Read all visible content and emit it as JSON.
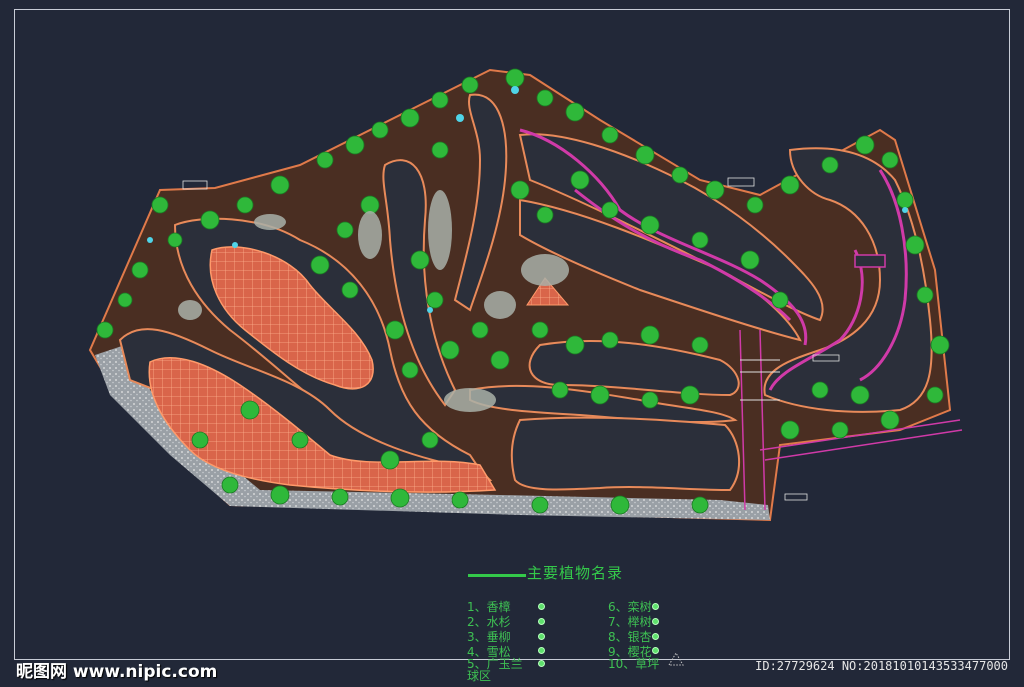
{
  "legend": {
    "title": "主要植物名录",
    "items_left": [
      {
        "label": "1、香樟"
      },
      {
        "label": "2、水杉"
      },
      {
        "label": "3、垂柳"
      },
      {
        "label": "4、雪松"
      },
      {
        "label": "5、广玉兰"
      }
    ],
    "items_left_extra": "球区",
    "items_right": [
      {
        "label": "6、栾树"
      },
      {
        "label": "7、榉树"
      },
      {
        "label": "8、银杏"
      },
      {
        "label": "9、樱花"
      },
      {
        "label": "10、草坪"
      }
    ]
  },
  "watermark": {
    "site": "昵图网 www.nipic.com",
    "id_text": "ID:27729624 NO:20181010143533477000"
  },
  "colors": {
    "background": "#222838",
    "tree_green": "#2fb83a",
    "fairway_dark": "#2b2f3a",
    "rough_brown": "#5a3626",
    "cart_path": "#e88a5a",
    "sand_hatch": "#e8734f",
    "water_magenta": "#d03aa8",
    "label_green": "#3ec153"
  }
}
